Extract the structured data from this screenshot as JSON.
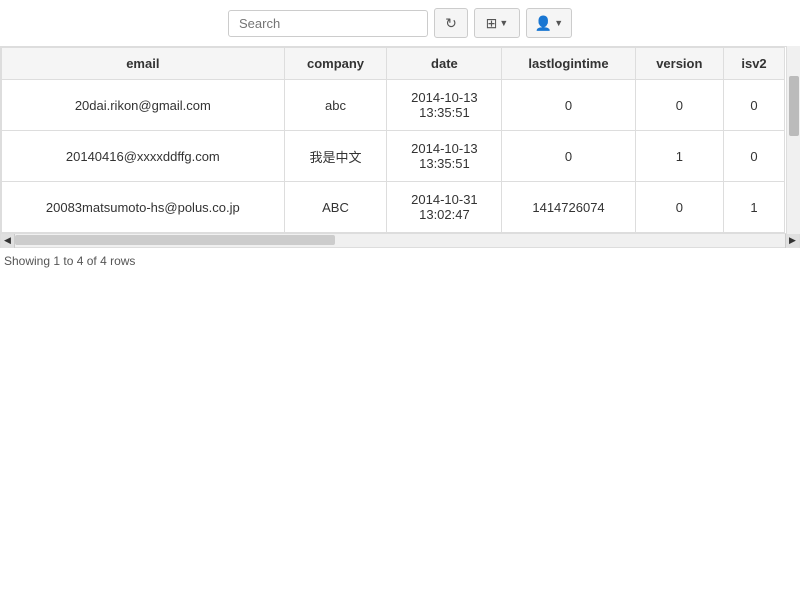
{
  "toolbar": {
    "search_placeholder": "Search",
    "refresh_icon": "↻",
    "grid_icon": "⊞",
    "user_icon": "👤"
  },
  "table": {
    "columns": [
      {
        "key": "email",
        "label": "email"
      },
      {
        "key": "company",
        "label": "company"
      },
      {
        "key": "date",
        "label": "date"
      },
      {
        "key": "lastlogintime",
        "label": "lastlogintime"
      },
      {
        "key": "version",
        "label": "version"
      },
      {
        "key": "isv2",
        "label": "isv2"
      }
    ],
    "rows": [
      {
        "email": "20dai.rikon@gmail.com",
        "company": "abc",
        "date": "2014-10-13 13:35:51",
        "lastlogintime": "0",
        "version": "0",
        "isv2": "0"
      },
      {
        "email": "20140416@xxxxddffg.com",
        "company": "我是中文",
        "date": "2014-10-13 13:35:51",
        "lastlogintime": "0",
        "version": "1",
        "isv2": "0"
      },
      {
        "email": "20083matsumoto-hs@polus.co.jp",
        "company": "ABC",
        "date": "2014-10-31 13:02:47",
        "lastlogintime": "1414726074",
        "version": "0",
        "isv2": "1"
      }
    ]
  },
  "status": {
    "text": "Showing 1 to 4 of 4 rows"
  }
}
